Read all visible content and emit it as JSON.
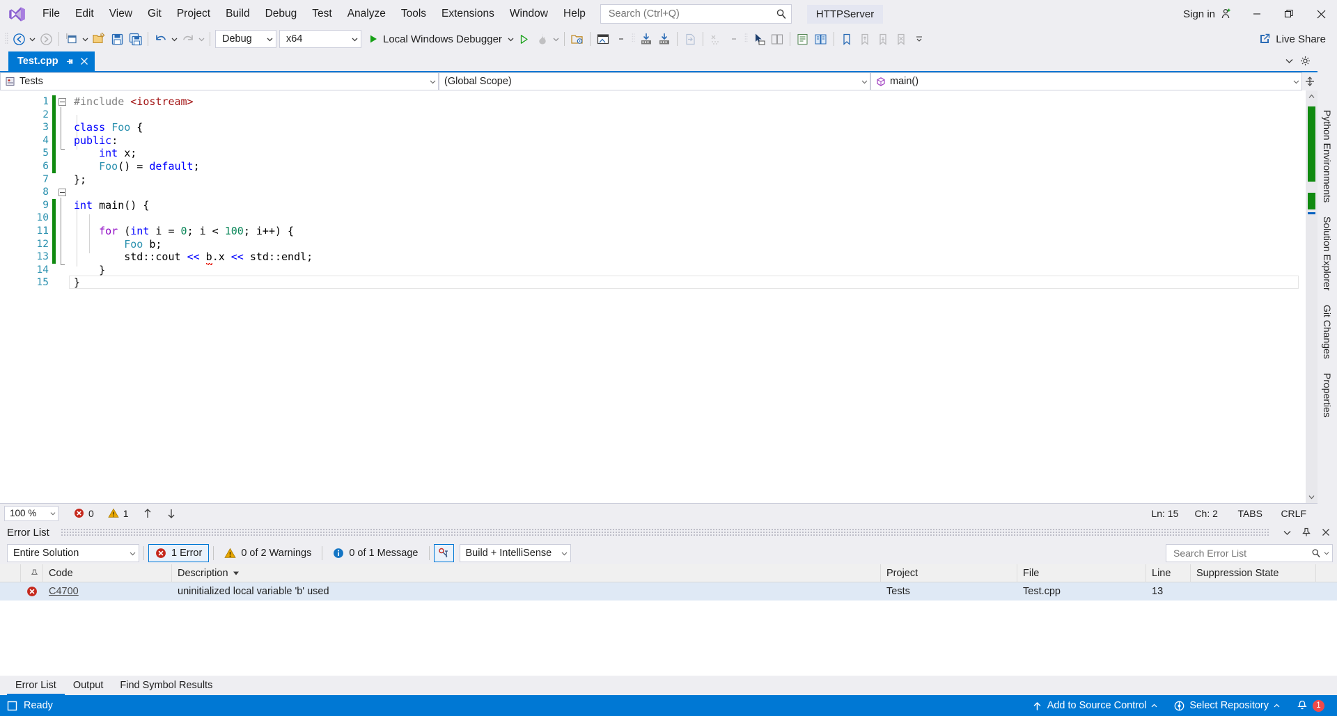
{
  "titlebar": {
    "logo_icon": "visual-studio-logo",
    "menus": [
      "File",
      "Edit",
      "View",
      "Git",
      "Project",
      "Build",
      "Debug",
      "Test",
      "Analyze",
      "Tools",
      "Extensions",
      "Window",
      "Help"
    ],
    "search_placeholder": "Search (Ctrl+Q)",
    "search_value": "",
    "search_icon": "magnifier-icon",
    "solution_name": "HTTPServer",
    "sign_in_label": "Sign in",
    "sign_in_icon": "account-add-icon",
    "minimize_icon": "minimize-icon",
    "maximize_icon": "restore-icon",
    "close_icon": "close-icon"
  },
  "toolbar": {
    "back_icon": "navigate-back-icon",
    "forward_icon": "navigate-forward-icon",
    "new_project_icon": "new-project-icon",
    "open_file_icon": "open-file-icon",
    "save_icon": "save-icon",
    "save_all_icon": "save-all-icon",
    "undo_icon": "undo-icon",
    "redo_icon": "redo-icon",
    "configuration": "Debug",
    "platform": "x64",
    "run_label": "Local Windows Debugger",
    "run_icon": "play-icon",
    "attach_icon": "play-outline-icon",
    "hot_reload_icon": "hot-reload-icon",
    "select_target_icon": "folder-target-icon",
    "window_layout_icon": "window-layout-icon",
    "step_into_icon": "step-into-icon",
    "step_over_icon": "step-over-icon",
    "goto_icon": "goto-icon",
    "no_data_icon": "no-data-icon",
    "pointer_icon": "pointer-icon",
    "compare_icon": "compare-icon",
    "source_icon": "source-icon",
    "diff_icon": "diff-icon",
    "bookmark_icon": "bookmark-icon",
    "bookmark_prev_icon": "bookmark-prev-icon",
    "bookmark_next_icon": "bookmark-next-icon",
    "bookmark_clear_icon": "bookmark-clear-icon",
    "overflow_icon": "overflow-chevron-icon",
    "live_share_label": "Live Share",
    "live_share_icon": "live-share-icon"
  },
  "document": {
    "tab_label": "Test.cpp",
    "tab_file_icon": "cpp-file-icon",
    "tab_pin_icon": "pin-icon",
    "tab_close_icon": "close-icon",
    "tabstrip_chevron_icon": "chevron-down-icon",
    "tabstrip_settings_icon": "gear-icon"
  },
  "navbar": {
    "project": "Tests",
    "project_icon": "cpp-project-icon",
    "scope": "(Global Scope)",
    "member": "main()",
    "member_icon": "method-icon",
    "split_icon": "split-window-icon"
  },
  "code": {
    "language": "cpp",
    "lines": [
      {
        "n": 1,
        "text": "#include <iostream>"
      },
      {
        "n": 2,
        "text": ""
      },
      {
        "n": 3,
        "text": "class Foo {"
      },
      {
        "n": 4,
        "text": "public:"
      },
      {
        "n": 5,
        "text": "    int x;"
      },
      {
        "n": 6,
        "text": "    Foo() = default;"
      },
      {
        "n": 7,
        "text": "};"
      },
      {
        "n": 8,
        "text": ""
      },
      {
        "n": 9,
        "text": "int main() {"
      },
      {
        "n": 10,
        "text": ""
      },
      {
        "n": 11,
        "text": "    for (int i = 0; i < 100; i++) {"
      },
      {
        "n": 12,
        "text": "        Foo b;"
      },
      {
        "n": 13,
        "text": "        std::cout << b.x << std::endl;"
      },
      {
        "n": 14,
        "text": "    }"
      },
      {
        "n": 15,
        "text": "}"
      }
    ]
  },
  "editor_status": {
    "zoom": "100 %",
    "error_icon": "error-icon",
    "error_count": "0",
    "warning_icon": "warning-icon",
    "warning_count": "1",
    "prev_icon": "arrow-up-icon",
    "next_icon": "arrow-down-icon",
    "line": "Ln: 15",
    "column": "Ch: 2",
    "indent": "TABS",
    "line_ending": "CRLF"
  },
  "right_rail": {
    "tabs": [
      "Python Environments",
      "Solution Explorer",
      "Git Changes",
      "Properties"
    ]
  },
  "error_list": {
    "title": "Error List",
    "collapse_icon": "chevron-down-icon",
    "pin_icon": "pin-icon",
    "close_icon": "close-icon",
    "scope_filter": "Entire Solution",
    "errors_label": "1 Error",
    "errors_icon": "error-icon",
    "warnings_label": "0 of 2 Warnings",
    "warnings_icon": "warning-icon",
    "messages_label": "0 of 1 Message",
    "messages_icon": "info-icon",
    "intellisense_toggle_icon": "intellisense-filter-icon",
    "source_filter": "Build + IntelliSense",
    "search_placeholder": "Search Error List",
    "search_value": "",
    "search_icon": "magnifier-icon",
    "search_dropdown_icon": "chevron-down-icon",
    "columns": [
      "",
      "",
      "Code",
      "Description",
      "Project",
      "File",
      "Line",
      "Suppression State"
    ],
    "sort_column": "Description",
    "sort_icon": "sort-descending-icon",
    "rows": [
      {
        "severity_icon": "error-icon",
        "code": "C4700",
        "description": "uninitialized local variable 'b' used",
        "project": "Tests",
        "file": "Test.cpp",
        "line": "13",
        "suppression_state": ""
      }
    ],
    "tabs": [
      "Error List",
      "Output",
      "Find Symbol Results"
    ],
    "selected_tab": "Error List"
  },
  "statusbar": {
    "ready_label": "Ready",
    "ready_icon": "stop-square-icon",
    "add_source_control_label": "Add to Source Control",
    "add_source_control_icon": "source-control-up-icon",
    "add_source_control_caret": "caret-up-icon",
    "select_repository_label": "Select Repository",
    "select_repository_icon": "repository-icon",
    "select_repository_caret": "caret-up-icon",
    "notification_icon": "bell-icon",
    "notification_count": "1"
  },
  "colors": {
    "accent": "#0078d4",
    "titlebar_bg": "#eeeef2",
    "editor_bg": "#ffffff",
    "error_red": "#e51400",
    "warning_yellow": "#e9a700",
    "changed_green": "#108a10",
    "selection_blue": "#dfe9f5"
  }
}
